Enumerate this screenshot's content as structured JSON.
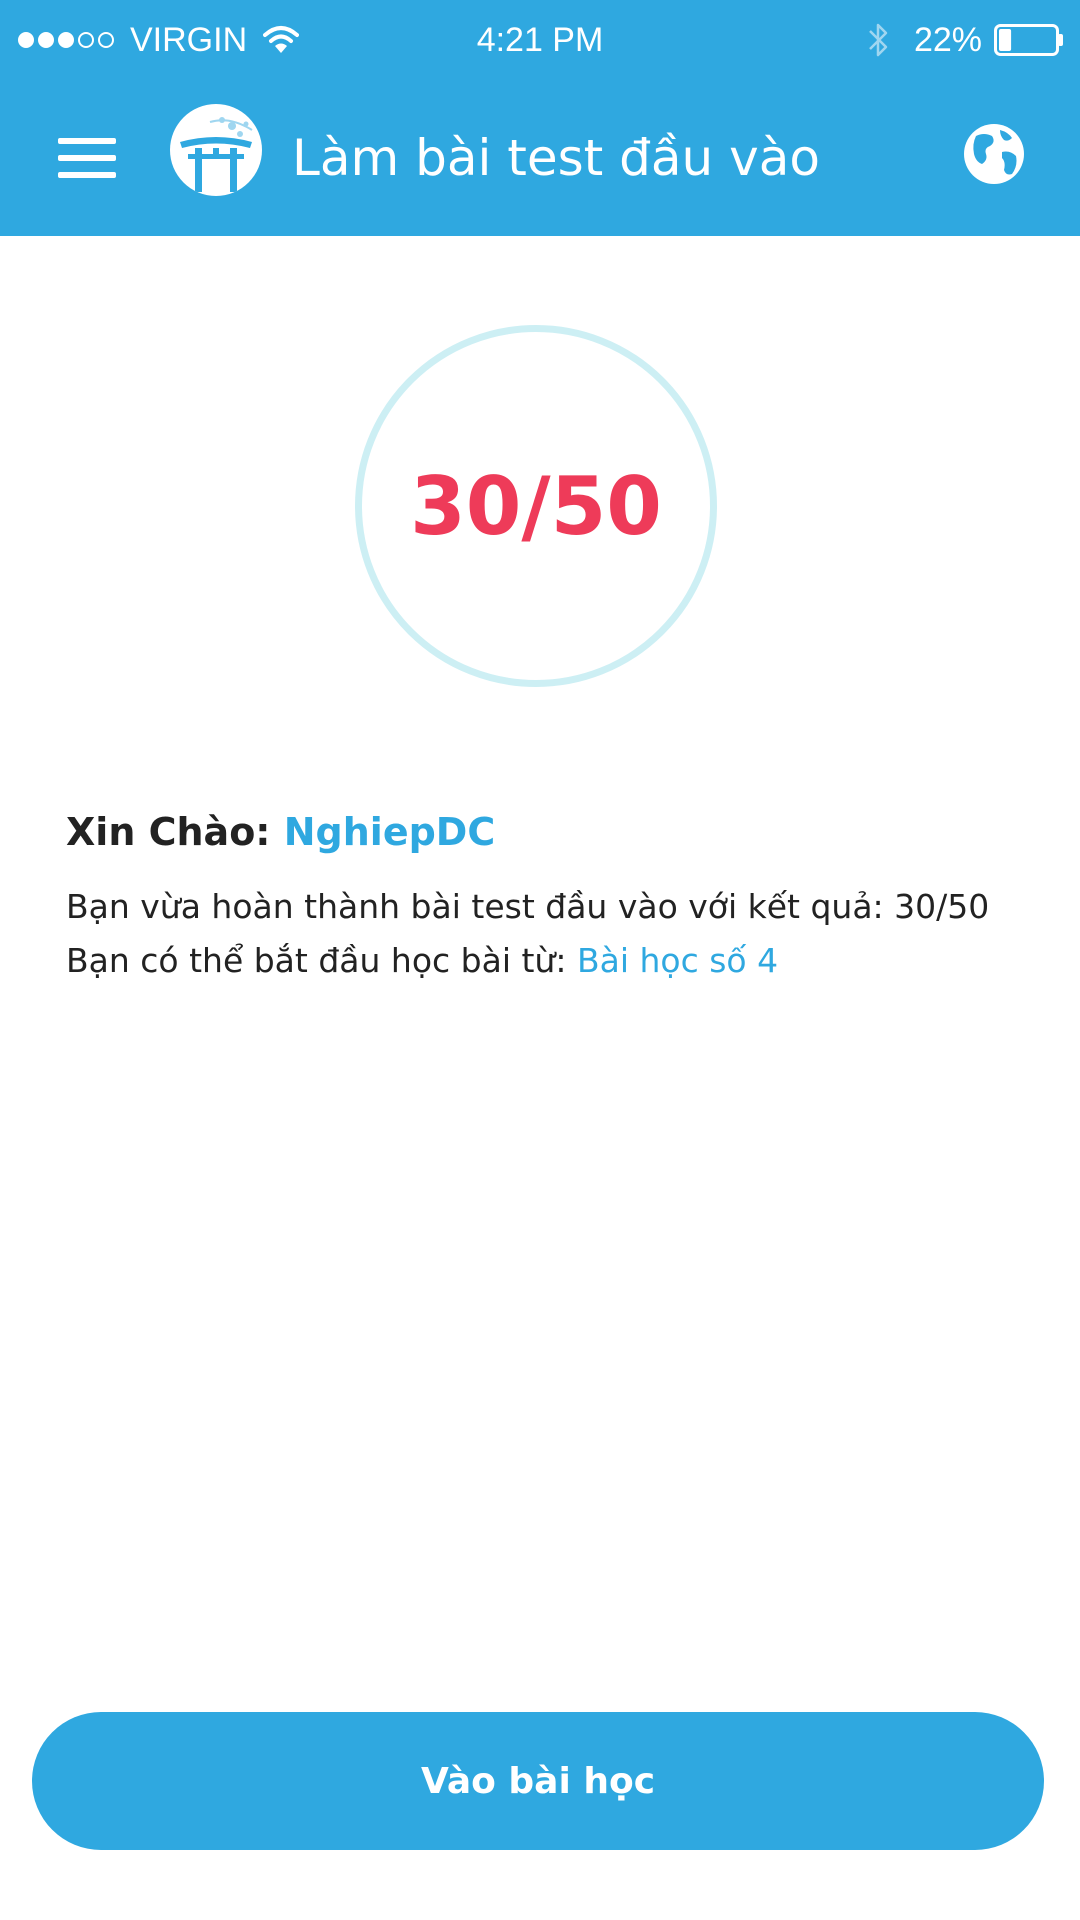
{
  "status_bar": {
    "signal_dots_filled": 3,
    "signal_dots_total": 5,
    "carrier": "VIRGIN",
    "time": "4:21 PM",
    "battery_percent": "22%",
    "battery_level": 0.22,
    "icons": [
      "wifi-icon",
      "bluetooth-icon",
      "battery-icon"
    ]
  },
  "app_bar": {
    "title": "Làm bài test đầu vào",
    "icons": [
      "hamburger-menu-icon",
      "torii-gate-logo",
      "globe-icon"
    ]
  },
  "score": {
    "display": "30/50",
    "value": 30,
    "max": 50
  },
  "greeting": {
    "label": "Xin Chào:",
    "username": "NghiepDC"
  },
  "message": {
    "line1": "Bạn vừa hoàn thành bài test đầu vào với kết quả: 30/50",
    "line2_prefix": "Bạn có thể bắt đầu học bài từ:",
    "lesson_link": "Bài học số 4"
  },
  "actions": {
    "start_label": "Vào bài học"
  },
  "colors": {
    "primary": "#2fa8e0",
    "score": "#ee3b59",
    "ring": "#cdeff4",
    "text": "#222222",
    "background": "#ffffff"
  }
}
